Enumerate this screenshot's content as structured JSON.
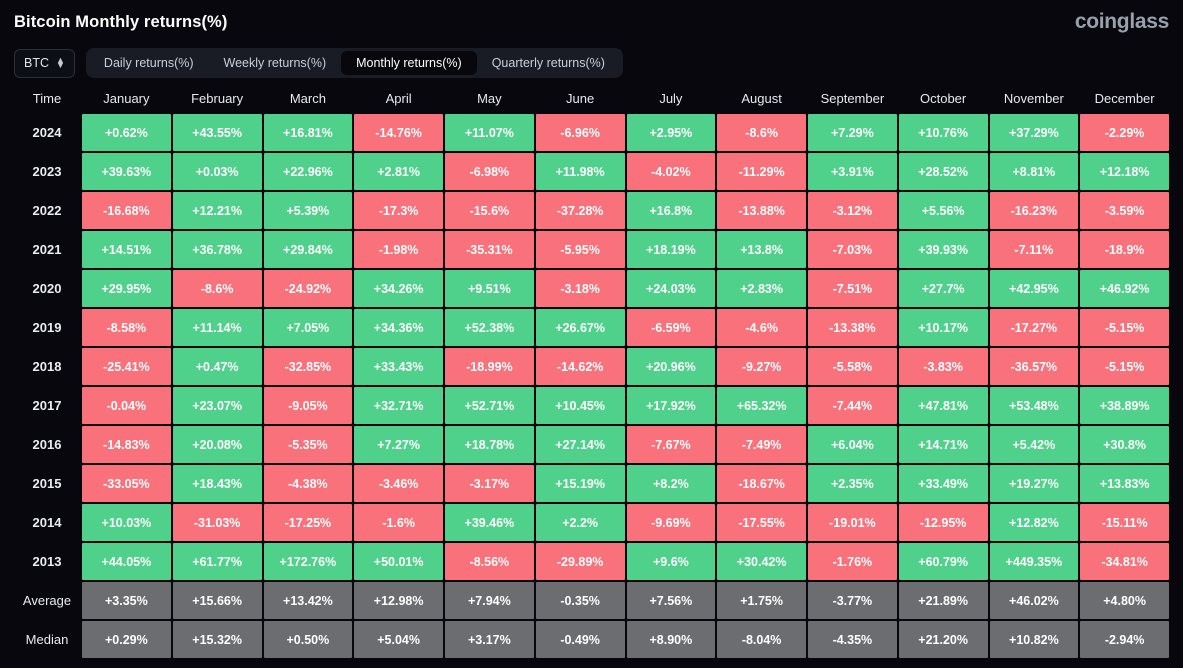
{
  "header": {
    "title": "Bitcoin Monthly returns(%)",
    "brand": "coinglass"
  },
  "toolbar": {
    "symbol": "BTC",
    "symbol_icon": "stepper-updown-icon",
    "tabs": [
      {
        "label": "Daily returns(%)",
        "active": false
      },
      {
        "label": "Weekly returns(%)",
        "active": false
      },
      {
        "label": "Monthly returns(%)",
        "active": true
      },
      {
        "label": "Quarterly returns(%)",
        "active": false
      }
    ]
  },
  "colors": {
    "positive": "#4fd18b",
    "negative": "#f8717b",
    "summary": "#6b6d70",
    "background": "#07070d"
  },
  "chart_data": {
    "type": "heatmap",
    "title": "Bitcoin Monthly returns(%)",
    "columns": [
      "Time",
      "January",
      "February",
      "March",
      "April",
      "May",
      "June",
      "July",
      "August",
      "September",
      "October",
      "November",
      "December"
    ],
    "rows": [
      {
        "label": "2024",
        "kind": "year",
        "values": [
          "+0.62%",
          "+43.55%",
          "+16.81%",
          "-14.76%",
          "+11.07%",
          "-6.96%",
          "+2.95%",
          "-8.6%",
          "+7.29%",
          "+10.76%",
          "+37.29%",
          "-2.29%"
        ]
      },
      {
        "label": "2023",
        "kind": "year",
        "values": [
          "+39.63%",
          "+0.03%",
          "+22.96%",
          "+2.81%",
          "-6.98%",
          "+11.98%",
          "-4.02%",
          "-11.29%",
          "+3.91%",
          "+28.52%",
          "+8.81%",
          "+12.18%"
        ]
      },
      {
        "label": "2022",
        "kind": "year",
        "values": [
          "-16.68%",
          "+12.21%",
          "+5.39%",
          "-17.3%",
          "-15.6%",
          "-37.28%",
          "+16.8%",
          "-13.88%",
          "-3.12%",
          "+5.56%",
          "-16.23%",
          "-3.59%"
        ]
      },
      {
        "label": "2021",
        "kind": "year",
        "values": [
          "+14.51%",
          "+36.78%",
          "+29.84%",
          "-1.98%",
          "-35.31%",
          "-5.95%",
          "+18.19%",
          "+13.8%",
          "-7.03%",
          "+39.93%",
          "-7.11%",
          "-18.9%"
        ]
      },
      {
        "label": "2020",
        "kind": "year",
        "values": [
          "+29.95%",
          "-8.6%",
          "-24.92%",
          "+34.26%",
          "+9.51%",
          "-3.18%",
          "+24.03%",
          "+2.83%",
          "-7.51%",
          "+27.7%",
          "+42.95%",
          "+46.92%"
        ]
      },
      {
        "label": "2019",
        "kind": "year",
        "values": [
          "-8.58%",
          "+11.14%",
          "+7.05%",
          "+34.36%",
          "+52.38%",
          "+26.67%",
          "-6.59%",
          "-4.6%",
          "-13.38%",
          "+10.17%",
          "-17.27%",
          "-5.15%"
        ]
      },
      {
        "label": "2018",
        "kind": "year",
        "values": [
          "-25.41%",
          "+0.47%",
          "-32.85%",
          "+33.43%",
          "-18.99%",
          "-14.62%",
          "+20.96%",
          "-9.27%",
          "-5.58%",
          "-3.83%",
          "-36.57%",
          "-5.15%"
        ]
      },
      {
        "label": "2017",
        "kind": "year",
        "values": [
          "-0.04%",
          "+23.07%",
          "-9.05%",
          "+32.71%",
          "+52.71%",
          "+10.45%",
          "+17.92%",
          "+65.32%",
          "-7.44%",
          "+47.81%",
          "+53.48%",
          "+38.89%"
        ]
      },
      {
        "label": "2016",
        "kind": "year",
        "values": [
          "-14.83%",
          "+20.08%",
          "-5.35%",
          "+7.27%",
          "+18.78%",
          "+27.14%",
          "-7.67%",
          "-7.49%",
          "+6.04%",
          "+14.71%",
          "+5.42%",
          "+30.8%"
        ]
      },
      {
        "label": "2015",
        "kind": "year",
        "values": [
          "-33.05%",
          "+18.43%",
          "-4.38%",
          "-3.46%",
          "-3.17%",
          "+15.19%",
          "+8.2%",
          "-18.67%",
          "+2.35%",
          "+33.49%",
          "+19.27%",
          "+13.83%"
        ]
      },
      {
        "label": "2014",
        "kind": "year",
        "values": [
          "+10.03%",
          "-31.03%",
          "-17.25%",
          "-1.6%",
          "+39.46%",
          "+2.2%",
          "-9.69%",
          "-17.55%",
          "-19.01%",
          "-12.95%",
          "+12.82%",
          "-15.11%"
        ]
      },
      {
        "label": "2013",
        "kind": "year",
        "values": [
          "+44.05%",
          "+61.77%",
          "+172.76%",
          "+50.01%",
          "-8.56%",
          "-29.89%",
          "+9.6%",
          "+30.42%",
          "-1.76%",
          "+60.79%",
          "+449.35%",
          "-34.81%"
        ]
      },
      {
        "label": "Average",
        "kind": "stat",
        "values": [
          "+3.35%",
          "+15.66%",
          "+13.42%",
          "+12.98%",
          "+7.94%",
          "-0.35%",
          "+7.56%",
          "+1.75%",
          "-3.77%",
          "+21.89%",
          "+46.02%",
          "+4.80%"
        ]
      },
      {
        "label": "Median",
        "kind": "stat",
        "values": [
          "+0.29%",
          "+15.32%",
          "+0.50%",
          "+5.04%",
          "+3.17%",
          "-0.49%",
          "+8.90%",
          "-8.04%",
          "-4.35%",
          "+21.20%",
          "+10.82%",
          "-2.94%"
        ]
      }
    ]
  }
}
